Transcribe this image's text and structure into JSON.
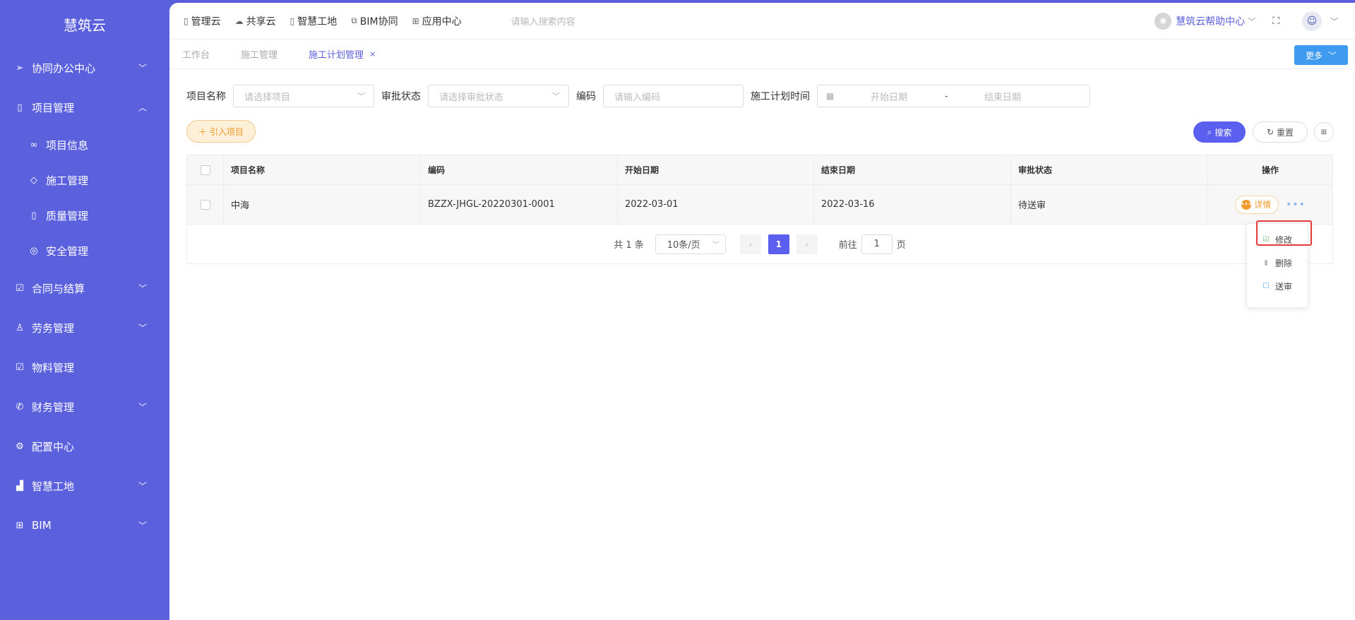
{
  "sidebar": {
    "logo": "慧筑云",
    "items": [
      {
        "label": "协同办公中心"
      },
      {
        "label": "项目管理"
      },
      {
        "label": "项目信息"
      },
      {
        "label": "施工管理"
      },
      {
        "label": "质量管理"
      },
      {
        "label": "安全管理"
      },
      {
        "label": "合同与结算"
      },
      {
        "label": "劳务管理"
      },
      {
        "label": "物料管理"
      },
      {
        "label": "财务管理"
      },
      {
        "label": "配置中心"
      },
      {
        "label": "智慧工地"
      },
      {
        "label": "BIM"
      }
    ]
  },
  "topnav": {
    "items": [
      "管理云",
      "共享云",
      "智慧工地",
      "BIM协同",
      "应用中心"
    ],
    "search_placeholder": "请输入搜索内容",
    "help": "慧筑云帮助中心"
  },
  "tabs": {
    "items": [
      "工作台",
      "施工管理",
      "施工计划管理"
    ],
    "more": "更多"
  },
  "filters": {
    "project_label": "项目名称",
    "project_placeholder": "请选择项目",
    "status_label": "审批状态",
    "status_placeholder": "请选择审批状态",
    "code_label": "编码",
    "code_placeholder": "请输入编码",
    "time_label": "施工计划时间",
    "start_placeholder": "开始日期",
    "range_sep": "-",
    "end_placeholder": "结束日期"
  },
  "actions": {
    "import": "引入项目",
    "search": "搜索",
    "reset": "重置"
  },
  "table": {
    "headers": [
      "项目名称",
      "编码",
      "开始日期",
      "结束日期",
      "审批状态",
      "操作"
    ],
    "rows": [
      {
        "name": "中海",
        "code": "BZZX-JHGL-20220301-0001",
        "start": "2022-03-01",
        "end": "2022-03-16",
        "status": "待送审",
        "detail": "详情"
      }
    ]
  },
  "pager": {
    "total": "共 1 条",
    "page_size": "10条/页",
    "current": "1",
    "goto_label": "前往",
    "goto_value": "1",
    "page_suffix": "页"
  },
  "dropdown": {
    "items": [
      "修改",
      "删除",
      "送审"
    ]
  }
}
